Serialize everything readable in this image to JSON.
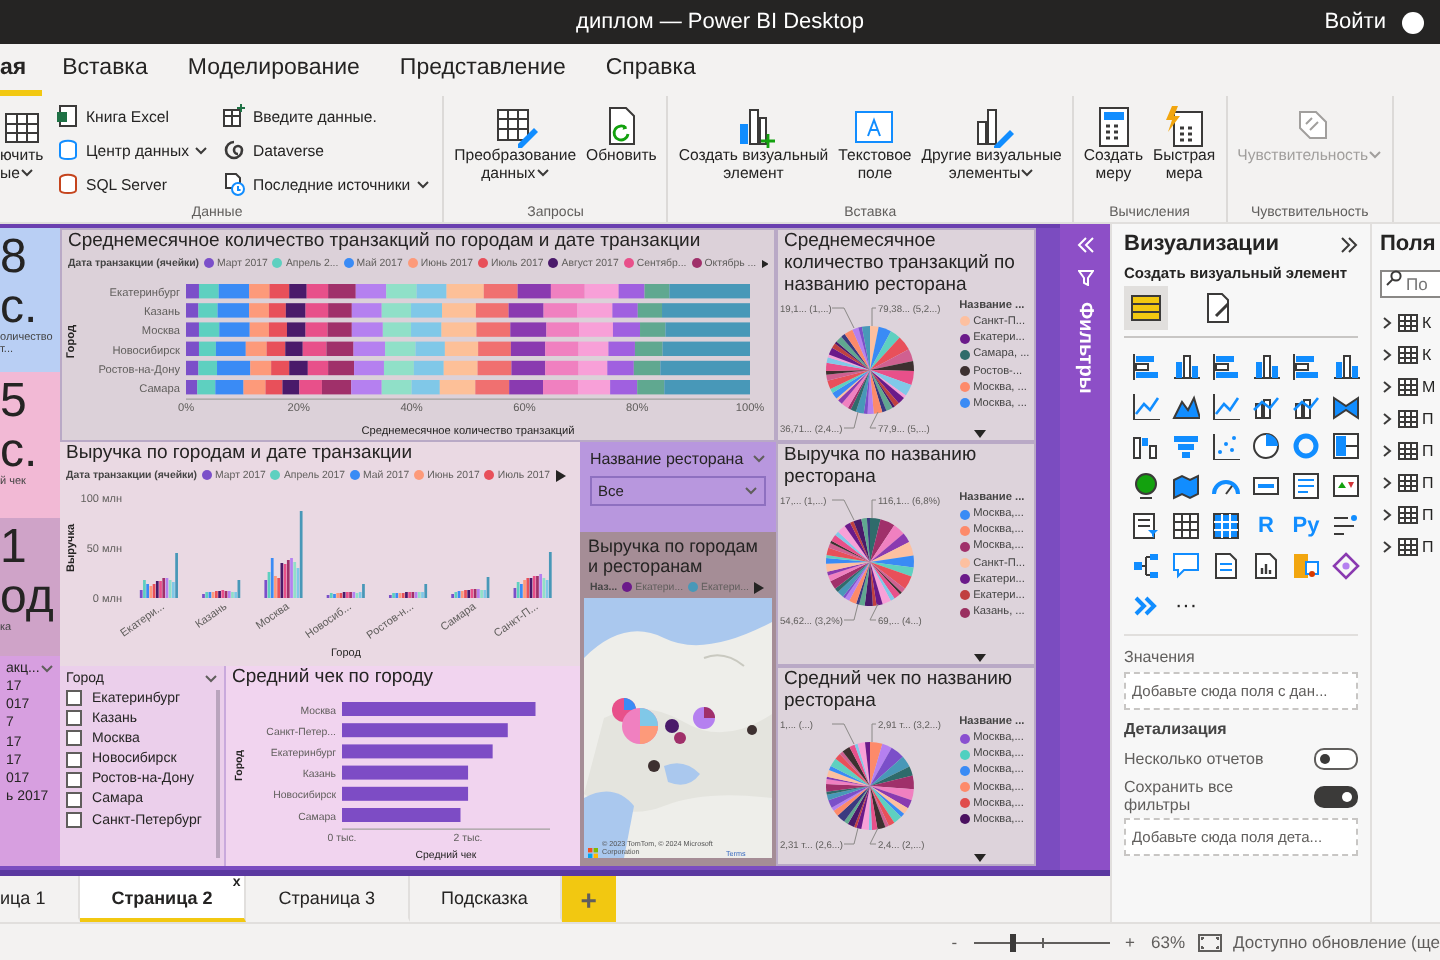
{
  "window": {
    "title": "диплом — Power BI Desktop",
    "sign_in": "Войти"
  },
  "menu_tabs": [
    {
      "label": "ая",
      "selected": true
    },
    {
      "label": "Вставка",
      "selected": false
    },
    {
      "label": "Моделирование",
      "selected": false
    },
    {
      "label": "Представление",
      "selected": false
    },
    {
      "label": "Справка",
      "selected": false
    }
  ],
  "ribbon": {
    "groups": [
      {
        "label": "Данные",
        "items": [
          {
            "kind": "large",
            "lines": [
              "ючить",
              "ые"
            ],
            "dropdown": true,
            "disabled": false
          },
          {
            "kind": "small",
            "lines": [
              "Книга Excel"
            ],
            "dropdown": false,
            "disabled": false
          },
          {
            "kind": "small",
            "lines": [
              "Центр данных"
            ],
            "dropdown": true,
            "disabled": false
          },
          {
            "kind": "small",
            "lines": [
              "SQL Server"
            ],
            "dropdown": false,
            "disabled": false
          },
          {
            "kind": "small",
            "lines": [
              "Введите данные."
            ],
            "dropdown": false,
            "disabled": false
          },
          {
            "kind": "small",
            "lines": [
              "Dataverse"
            ],
            "dropdown": false,
            "disabled": false
          },
          {
            "kind": "small",
            "lines": [
              "Последние источники"
            ],
            "dropdown": true,
            "disabled": false
          }
        ]
      },
      {
        "label": "Запросы",
        "items": [
          {
            "kind": "large",
            "lines": [
              "Преобразование",
              "данных"
            ],
            "dropdown": true,
            "disabled": false
          },
          {
            "kind": "large",
            "lines": [
              "Обновить"
            ],
            "dropdown": false,
            "disabled": false
          }
        ]
      },
      {
        "label": "Вставка",
        "items": [
          {
            "kind": "large",
            "lines": [
              "Создать визуальный",
              "элемент"
            ],
            "dropdown": false,
            "disabled": false
          },
          {
            "kind": "large",
            "lines": [
              "Текстовое",
              "поле"
            ],
            "dropdown": false,
            "disabled": false
          },
          {
            "kind": "large",
            "lines": [
              "Другие визуальные",
              "элементы"
            ],
            "dropdown": true,
            "disabled": false
          }
        ]
      },
      {
        "label": "Вычисления",
        "items": [
          {
            "kind": "large",
            "lines": [
              "Создать",
              "меру"
            ],
            "dropdown": false,
            "disabled": false
          },
          {
            "kind": "large",
            "lines": [
              "Быстрая",
              "мера"
            ],
            "dropdown": false,
            "disabled": false
          }
        ]
      },
      {
        "label": "Чувствительность",
        "items": [
          {
            "kind": "large",
            "lines": [
              "Чувствительность"
            ],
            "dropdown": true,
            "disabled": true
          }
        ]
      }
    ]
  },
  "report": {
    "kpi_cards": [
      {
        "value": "8 с.",
        "label": "оличество т..."
      },
      {
        "value": "5 с.",
        "label": "й чек"
      },
      {
        "value": "1 од",
        "label": "ка"
      }
    ],
    "stacked_bar": {
      "legend_title": "Дата транзакции (ячейки)",
      "chart_data": {
        "type": "bar",
        "title": "Среднемесячное количество транзакций по городам и дате транзакции",
        "orientation": "horizontal",
        "stacked": true,
        "xlabel": "Среднемесячное количество транзакций",
        "ylabel": "Город",
        "categories": [
          "Екатеринбург",
          "Казань",
          "Москва",
          "Новосибирск",
          "Ростов-на-Дону",
          "Самара"
        ],
        "xlim": [
          0,
          100
        ],
        "xticks": [
          {
            "value": 0,
            "label": "0%"
          },
          {
            "value": 20,
            "label": "20%"
          },
          {
            "value": 40,
            "label": "40%"
          },
          {
            "value": 60,
            "label": "60%"
          },
          {
            "value": 80,
            "label": "80%"
          },
          {
            "value": 100,
            "label": "100%"
          }
        ],
        "series": [
          {
            "name": "Март 2017",
            "color": "#7b4fc9",
            "values": [
              2.3,
              2.2,
              2.3,
              2.3,
              2.2,
              2.0
            ]
          },
          {
            "name": "Апрель 2...",
            "color": "#5ed0c0",
            "values": [
              3.5,
              3.4,
              3.6,
              3.0,
              3.3,
              3.2
            ]
          },
          {
            "name": "Май 2017",
            "color": "#3a8bf5",
            "values": [
              5.4,
              5.6,
              5.4,
              5.3,
              5.9,
              5.0
            ]
          },
          {
            "name": "Июнь 2017",
            "color": "#fd9a7a",
            "values": [
              3.6,
              3.5,
              3.4,
              3.7,
              3.7,
              3.9
            ]
          },
          {
            "name": "Июль 2017",
            "color": "#e8505a",
            "values": [
              3.5,
              3.0,
              3.2,
              3.3,
              3.2,
              3.0
            ]
          },
          {
            "name": "Август 2017",
            "color": "#4a1a6a",
            "values": [
              3.1,
              3.5,
              3.3,
              3.1,
              3.3,
              3.0
            ]
          },
          {
            "name": "Сентябр...",
            "color": "#e8508a",
            "values": [
              3.8,
              4.0,
              3.9,
              4.2,
              3.6,
              4.0
            ]
          },
          {
            "name": "Октябрь ...",
            "color": "#a0306a",
            "values": [
              4.9,
              4.2,
              4.3,
              4.8,
              4.6,
              5.2
            ]
          },
          {
            "color": "#b580f0",
            "values": [
              5.4,
              5.3,
              5.5,
              5.6,
              5.3,
              5.4
            ]
          },
          {
            "color": "#90e0c8",
            "values": [
              5.4,
              5.2,
              5.0,
              5.4,
              5.3,
              5.3
            ]
          },
          {
            "color": "#80c8e8",
            "values": [
              5.3,
              5.5,
              5.4,
              5.2,
              5.3,
              5.0
            ]
          },
          {
            "color": "#fdc098",
            "values": [
              6.6,
              6.0,
              6.2,
              5.9,
              6.0,
              6.3
            ]
          },
          {
            "color": "#f07070",
            "values": [
              6.0,
              5.8,
              6.0,
              5.8,
              6.0,
              6.0
            ]
          },
          {
            "color": "#8a3ab0",
            "values": [
              5.9,
              6.2,
              6.4,
              6.1,
              6.0,
              6.0
            ]
          },
          {
            "color": "#f080c0",
            "values": [
              6.0,
              6.0,
              5.8,
              5.9,
              5.9,
              6.2
            ]
          },
          {
            "color": "#f8a0d8",
            "values": [
              6.0,
              6.2,
              6.0,
              5.3,
              5.1,
              5.7
            ]
          },
          {
            "color": "#a060e0",
            "values": [
              4.6,
              4.5,
              4.8,
              4.7,
              4.7,
              4.8
            ]
          },
          {
            "color": "#60a890",
            "values": [
              4.4,
              4.3,
              4.5,
              4.9,
              4.7,
              4.8
            ]
          },
          {
            "color": "#4898b8",
            "values": [
              14.3,
              15.6,
              15.0,
              15.5,
              15.9,
              15.2
            ]
          }
        ]
      }
    },
    "column_chart": {
      "legend_title": "Дата транзакции (ячейки)",
      "chart_data": {
        "type": "bar",
        "title": "Выручка по городам и дате транзакции",
        "orientation": "vertical",
        "stacked": false,
        "xlabel": "Город",
        "ylabel": "Выручка",
        "categories": [
          "Екатери...",
          "Казань",
          "Москва",
          "Новосиб...",
          "Ростов-н...",
          "Самара",
          "Санкт-П..."
        ],
        "ylim": [
          0,
          100
        ],
        "yticks": [
          {
            "value": 0,
            "label": "0 млн"
          },
          {
            "value": 50,
            "label": "50 млн"
          },
          {
            "value": 100,
            "label": "100 млн"
          }
        ],
        "series": [
          {
            "name": "Март 2017",
            "color": "#7b4fc9",
            "values": [
              8,
              4,
              18,
              3,
              3,
              4,
              10
            ]
          },
          {
            "name": "Апрель 2017",
            "color": "#5ed0c0",
            "values": [
              18,
              6,
              26,
              5,
              5,
              6,
              16
            ]
          },
          {
            "name": "Май 2017",
            "color": "#3a8bf5",
            "values": [
              14,
              6,
              40,
              4,
              5,
              7,
              14
            ]
          },
          {
            "name": "Июнь 2017",
            "color": "#fd9a7a",
            "values": [
              12,
              6,
              22,
              5,
              5,
              7,
              18
            ]
          },
          {
            "name": "Июль 2017",
            "color": "#e8505a",
            "values": [
              14,
              7,
              20,
              5,
              5,
              8,
              20
            ]
          },
          {
            "color": "#4a1a6a",
            "values": [
              17,
              7,
              35,
              6,
              6,
              8,
              20
            ]
          },
          {
            "color": "#e8508a",
            "values": [
              17,
              8,
              34,
              6,
              6,
              9,
              22
            ]
          },
          {
            "color": "#a0306a",
            "values": [
              20,
              7,
              38,
              6,
              6,
              9,
              22
            ]
          },
          {
            "color": "#b580f0",
            "values": [
              20,
              7,
              40,
              6,
              6,
              9,
              24
            ]
          },
          {
            "color": "#90e0c8",
            "values": [
              18,
              6,
              36,
              5,
              6,
              8,
              20
            ]
          },
          {
            "color": "#80c8e8",
            "values": [
              16,
              6,
              30,
              6,
              6,
              8,
              18
            ]
          },
          {
            "color": "#4898b8",
            "values": [
              45,
              18,
              87,
              14,
              14,
              21,
              46
            ]
          }
        ]
      }
    },
    "restaurant_slicer": {
      "header": "Название ресторана",
      "value": "Все"
    },
    "map": {
      "title": "Выручка по городам и ресторанам",
      "legend_title": "Наз...",
      "legend": [
        {
          "label": "Екатери...",
          "color": "#6b1a8a"
        },
        {
          "label": "Екатери...",
          "color": "#4898b8"
        }
      ],
      "attribution": "© 2023 TomTom, © 2024 Microsoft Corporation",
      "terms": "Terms"
    },
    "pies": [
      {
        "title": "Среднемесячное количество транзакций по названию ресторана",
        "legend_title": "Название ...",
        "labels": [
          "19,1... (1,...)",
          "79,38... (5,2...)",
          "36,71... (2,4...)",
          "77,9... (5,...)"
        ],
        "legend": [
          {
            "label": "Санкт-П...",
            "color": "#fdc0a0"
          },
          {
            "label": "Екатери...",
            "color": "#6b1a8a"
          },
          {
            "label": "Самара, ...",
            "color": "#2f6b6b"
          },
          {
            "label": "Ростов-...",
            "color": "#3d3030"
          },
          {
            "label": "Москва, ...",
            "color": "#fd8a6a"
          },
          {
            "label": "Москва, ...",
            "color": "#3a8bf5"
          }
        ]
      },
      {
        "title": "Выручка по названию ресторана",
        "legend_title": "Название ...",
        "labels": [
          "17,... (1,...)",
          "116,1... (6,8%)",
          "54,62... (3,2%)",
          "69,... (4...)"
        ],
        "legend": [
          {
            "label": "Москва,...",
            "color": "#3a8bf5"
          },
          {
            "label": "Москва,...",
            "color": "#fd8a6a"
          },
          {
            "label": "Москва,...",
            "color": "#a0306a"
          },
          {
            "label": "Санкт-П...",
            "color": "#fdc0a0"
          },
          {
            "label": "Екатери...",
            "color": "#6b1a8a"
          },
          {
            "label": "Екатери...",
            "color": "#c04040"
          },
          {
            "label": "Казань, ...",
            "color": "#9a3060"
          }
        ]
      },
      {
        "title": "Средний чек по названию ресторана",
        "legend_title": "Название ...",
        "labels": [
          "1,... (...)",
          "2,91 т... (3,2...)",
          "2,31 т... (2,6...)",
          "2,4... (2,...)"
        ],
        "legend": [
          {
            "label": "Москва,...",
            "color": "#8a4fd0"
          },
          {
            "label": "Москва,...",
            "color": "#4fd0c0"
          },
          {
            "label": "Москва,...",
            "color": "#3a8bf5"
          },
          {
            "label": "Москва,...",
            "color": "#fd8a6a"
          },
          {
            "label": "Москва,...",
            "color": "#e04c4c"
          },
          {
            "label": "Москва,...",
            "color": "#4a1060"
          }
        ]
      }
    ],
    "date_slicer": {
      "header": "акц...",
      "items": [
        "17",
        "017",
        "7",
        "17",
        "17",
        "017",
        "ь 2017"
      ]
    },
    "city_slicer": {
      "header": "Город",
      "items": [
        {
          "label": "Екатеринбург",
          "checked": false
        },
        {
          "label": "Казань",
          "checked": false
        },
        {
          "label": "Москва",
          "checked": false
        },
        {
          "label": "Новосибирск",
          "checked": false
        },
        {
          "label": "Ростов-на-Дону",
          "checked": false
        },
        {
          "label": "Самара",
          "checked": false
        },
        {
          "label": "Санкт-Петербург",
          "checked": false
        }
      ]
    },
    "avg_bar": {
      "chart_data": {
        "type": "bar",
        "title": "Средний чек по городу",
        "orientation": "horizontal",
        "stacked": false,
        "xlabel": "Средний чек",
        "ylabel": "Город",
        "categories": [
          "Москва",
          "Санкт-Петер...",
          "Екатеринбург",
          "Казань",
          "Новосибирск",
          "Самара"
        ],
        "xlim": [
          0,
          3.3
        ],
        "xticks": [
          {
            "value": 0,
            "label": "0 тыс."
          },
          {
            "value": 2,
            "label": "2 тыс."
          }
        ],
        "series": [
          {
            "color": "#7d4cc5",
            "values": [
              3.07,
              2.63,
              2.39,
              2.0,
              2.0,
              1.88
            ]
          }
        ]
      }
    }
  },
  "filters_pane": {
    "title": "Фильтры"
  },
  "visualizations": {
    "title": "Визуализации",
    "subtitle": "Создать визуальный элемент",
    "tabs": [
      {
        "selected": true
      },
      {
        "selected": false
      }
    ],
    "types": [
      {
        "kind": "hbar"
      },
      {
        "kind": "vbar"
      },
      {
        "kind": "hbar"
      },
      {
        "kind": "vbar"
      },
      {
        "kind": "hbar"
      },
      {
        "kind": "vbar"
      },
      {
        "kind": "line"
      },
      {
        "kind": "area"
      },
      {
        "kind": "line"
      },
      {
        "kind": "combo"
      },
      {
        "kind": "combo"
      },
      {
        "kind": "ribbon"
      },
      {
        "kind": "waterfall"
      },
      {
        "kind": "funnel"
      },
      {
        "kind": "scatter"
      },
      {
        "kind": "pie"
      },
      {
        "kind": "donut"
      },
      {
        "kind": "treemap"
      },
      {
        "kind": "globe"
      },
      {
        "kind": "map"
      },
      {
        "kind": "gauge"
      },
      {
        "kind": "card"
      },
      {
        "kind": "multicard"
      },
      {
        "kind": "kpi"
      },
      {
        "kind": "slicer"
      },
      {
        "kind": "table"
      },
      {
        "kind": "matrix"
      },
      {
        "kind": "text",
        "label": "R"
      },
      {
        "kind": "text",
        "label": "Py"
      },
      {
        "kind": "influencers"
      },
      {
        "kind": "tree"
      },
      {
        "kind": "bubble"
      },
      {
        "kind": "narrative"
      },
      {
        "kind": "paginated"
      },
      {
        "kind": "puzzle"
      },
      {
        "kind": "diamond"
      },
      {
        "kind": "chevrons"
      },
      {
        "kind": "text",
        "label": "···"
      }
    ],
    "wells": [
      {
        "kind": "section",
        "text": "Значения"
      },
      {
        "kind": "drop",
        "text": "Добавьте сюда поля с дан..."
      },
      {
        "kind": "heading",
        "text": "Детализация"
      },
      {
        "kind": "toggle",
        "text": "Несколько отчетов",
        "on": false
      },
      {
        "kind": "toggle",
        "text": "Сохранить все фильтры",
        "on": true
      },
      {
        "kind": "drop",
        "text": "Добавьте сюда поля дета..."
      }
    ]
  },
  "fields": {
    "title": "Поля",
    "search": {
      "placeholder": "По"
    },
    "items": [
      {
        "label": "К",
        "expanded": false
      },
      {
        "label": "К",
        "expanded": false
      },
      {
        "label": "М",
        "expanded": false
      },
      {
        "label": "П",
        "expanded": false
      },
      {
        "label": "П",
        "expanded": false
      },
      {
        "label": "П",
        "expanded": false
      },
      {
        "label": "П",
        "expanded": false
      },
      {
        "label": "П",
        "expanded": false
      }
    ]
  },
  "page_tabs": {
    "tabs": [
      {
        "label": "ица 1",
        "selected": false
      },
      {
        "label": "Страница 2",
        "selected": true,
        "close": "x"
      },
      {
        "label": "Страница 3",
        "selected": false
      },
      {
        "label": "Подсказка",
        "selected": false
      }
    ],
    "add": "+"
  },
  "status_bar": {
    "zoom_out": "-",
    "zoom": {
      "level": 0.29
    },
    "zoom_in": "+",
    "zoom_text": "63%",
    "update": "Доступно обновление (ще"
  }
}
